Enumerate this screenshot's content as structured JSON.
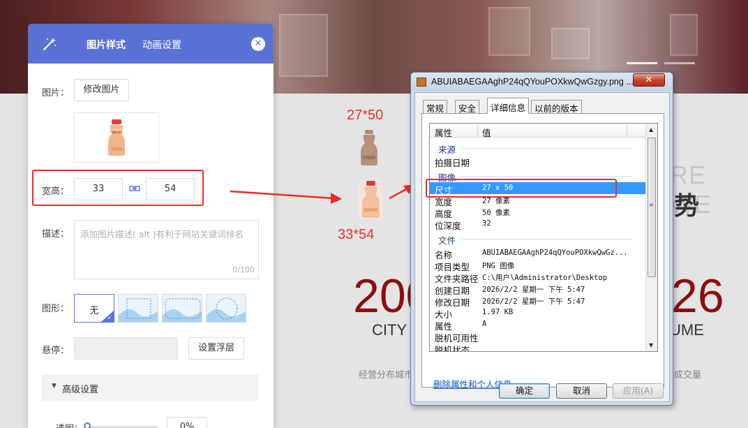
{
  "background": {
    "headline": "优势",
    "ghost_text": "RE WE",
    "stat_left": "200",
    "stat_right": "26",
    "caption_left": "CITY",
    "caption_right": "UME",
    "small_left": "经营分布城市",
    "small_right": "成交量"
  },
  "editor": {
    "tabs": [
      {
        "label": "图片样式"
      },
      {
        "label": "动画设置"
      }
    ],
    "image_label": "图片：",
    "change_image_button": "修改图片",
    "size_label": "宽高：",
    "width_value": "33",
    "height_value": "54",
    "desc_label": "描述：",
    "desc_placeholder": "添加图片描述( alt )有利于网站关键词排名",
    "desc_count": "0/100",
    "shape_label": "图形：",
    "shape_none": "无",
    "hover_label": "悬停：",
    "hover_button": "设置浮层",
    "advanced_label": "高级设置",
    "opacity_label": "透明：",
    "opacity_value": "0%"
  },
  "annotations": {
    "top_size": "27*50",
    "bottom_size": "33*54",
    "color": "#e8322a"
  },
  "dialog": {
    "title": "ABUIABAEGAAghP24qQYouPOXkwQwGzgy.png ...",
    "close_label": "✕",
    "tabs": [
      {
        "label": "常规"
      },
      {
        "label": "安全"
      },
      {
        "label": "详细信息"
      },
      {
        "label": "以前的版本"
      }
    ],
    "col_property": "属性",
    "col_value": "值",
    "group_source": "来源",
    "row_capture_date": "拍摄日期",
    "group_image": "图像",
    "rows_image": [
      {
        "key": "尺寸",
        "value": "27 x 50"
      },
      {
        "key": "宽度",
        "value": "27 像素"
      },
      {
        "key": "高度",
        "value": "50 像素"
      },
      {
        "key": "位深度",
        "value": "32"
      }
    ],
    "group_file": "文件",
    "rows_file": [
      {
        "key": "名称",
        "value": "ABUIABAEGAAghP24qQYouPOXkwQwGz..."
      },
      {
        "key": "项目类型",
        "value": "PNG 图像"
      },
      {
        "key": "文件夹路径",
        "value": "C:\\用户\\Administrator\\Desktop"
      },
      {
        "key": "创建日期",
        "value": "2026/2/2 星期一 下午 5:47"
      },
      {
        "key": "修改日期",
        "value": "2026/2/2 星期一 下午 5:47"
      },
      {
        "key": "大小",
        "value": "1.97 KB"
      },
      {
        "key": "属性",
        "value": "A"
      },
      {
        "key": "脱机可用性",
        "value": ""
      },
      {
        "key": "脱机状态",
        "value": ""
      }
    ],
    "remove_link": "删除属性和个人信息",
    "ok_button": "确定",
    "cancel_button": "取消",
    "apply_button": "应用(A)"
  },
  "colors": {
    "panel_accent": "#5a72d6",
    "highlight_red": "#ee2a24",
    "selection_blue": "#3399ff"
  }
}
